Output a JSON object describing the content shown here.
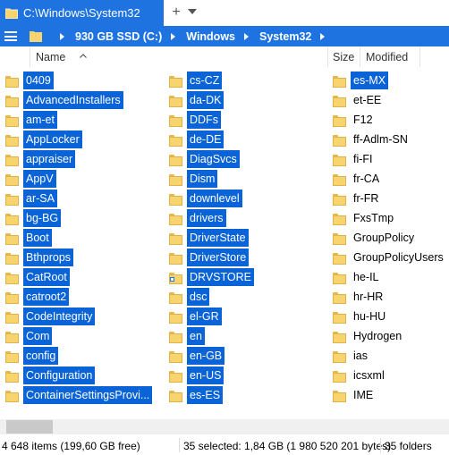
{
  "tab": {
    "title": "C:\\Windows\\System32",
    "add_label": "+"
  },
  "address": {
    "crumbs": [
      "930 GB SSD (C:)",
      "Windows",
      "System32"
    ]
  },
  "headers": {
    "name": "Name",
    "size": "Size",
    "modified": "Modified"
  },
  "columns": [
    [
      {
        "name": "0409",
        "selected": true
      },
      {
        "name": "AdvancedInstallers",
        "selected": true
      },
      {
        "name": "am-et",
        "selected": true
      },
      {
        "name": "AppLocker",
        "selected": true
      },
      {
        "name": "appraiser",
        "selected": true
      },
      {
        "name": "AppV",
        "selected": true
      },
      {
        "name": "ar-SA",
        "selected": true
      },
      {
        "name": "bg-BG",
        "selected": true
      },
      {
        "name": "Boot",
        "selected": true
      },
      {
        "name": "Bthprops",
        "selected": true
      },
      {
        "name": "CatRoot",
        "selected": true
      },
      {
        "name": "catroot2",
        "selected": true
      },
      {
        "name": "CodeIntegrity",
        "selected": true
      },
      {
        "name": "Com",
        "selected": true
      },
      {
        "name": "config",
        "selected": true
      },
      {
        "name": "Configuration",
        "selected": true
      },
      {
        "name": "ContainerSettingsProvi...",
        "selected": true
      }
    ],
    [
      {
        "name": "cs-CZ",
        "selected": true
      },
      {
        "name": "da-DK",
        "selected": true
      },
      {
        "name": "DDFs",
        "selected": true
      },
      {
        "name": "de-DE",
        "selected": true
      },
      {
        "name": "DiagSvcs",
        "selected": true
      },
      {
        "name": "Dism",
        "selected": true
      },
      {
        "name": "downlevel",
        "selected": true
      },
      {
        "name": "drivers",
        "selected": true
      },
      {
        "name": "DriverState",
        "selected": true
      },
      {
        "name": "DriverStore",
        "selected": true
      },
      {
        "name": "DRVSTORE",
        "selected": true,
        "shortcut": true
      },
      {
        "name": "dsc",
        "selected": true
      },
      {
        "name": "el-GR",
        "selected": true
      },
      {
        "name": "en",
        "selected": true
      },
      {
        "name": "en-GB",
        "selected": true
      },
      {
        "name": "en-US",
        "selected": true
      },
      {
        "name": "es-ES",
        "selected": true
      }
    ],
    [
      {
        "name": "es-MX",
        "selected": true
      },
      {
        "name": "et-EE",
        "selected": false
      },
      {
        "name": "F12",
        "selected": false
      },
      {
        "name": "ff-Adlm-SN",
        "selected": false
      },
      {
        "name": "fi-FI",
        "selected": false
      },
      {
        "name": "fr-CA",
        "selected": false
      },
      {
        "name": "fr-FR",
        "selected": false
      },
      {
        "name": "FxsTmp",
        "selected": false
      },
      {
        "name": "GroupPolicy",
        "selected": false
      },
      {
        "name": "GroupPolicyUsers",
        "selected": false
      },
      {
        "name": "he-IL",
        "selected": false
      },
      {
        "name": "hr-HR",
        "selected": false
      },
      {
        "name": "hu-HU",
        "selected": false
      },
      {
        "name": "Hydrogen",
        "selected": false
      },
      {
        "name": "ias",
        "selected": false
      },
      {
        "name": "icsxml",
        "selected": false
      },
      {
        "name": "IME",
        "selected": false
      }
    ]
  ],
  "status": {
    "items": "4 648 items (199,60 GB free)",
    "selected": "35 selected: 1,84 GB (1 980 520 201 bytes)",
    "folders": "35 folders"
  },
  "colors": {
    "accent": "#1e73e0",
    "selection": "#0a64d8",
    "folder": "#f7d46e"
  }
}
